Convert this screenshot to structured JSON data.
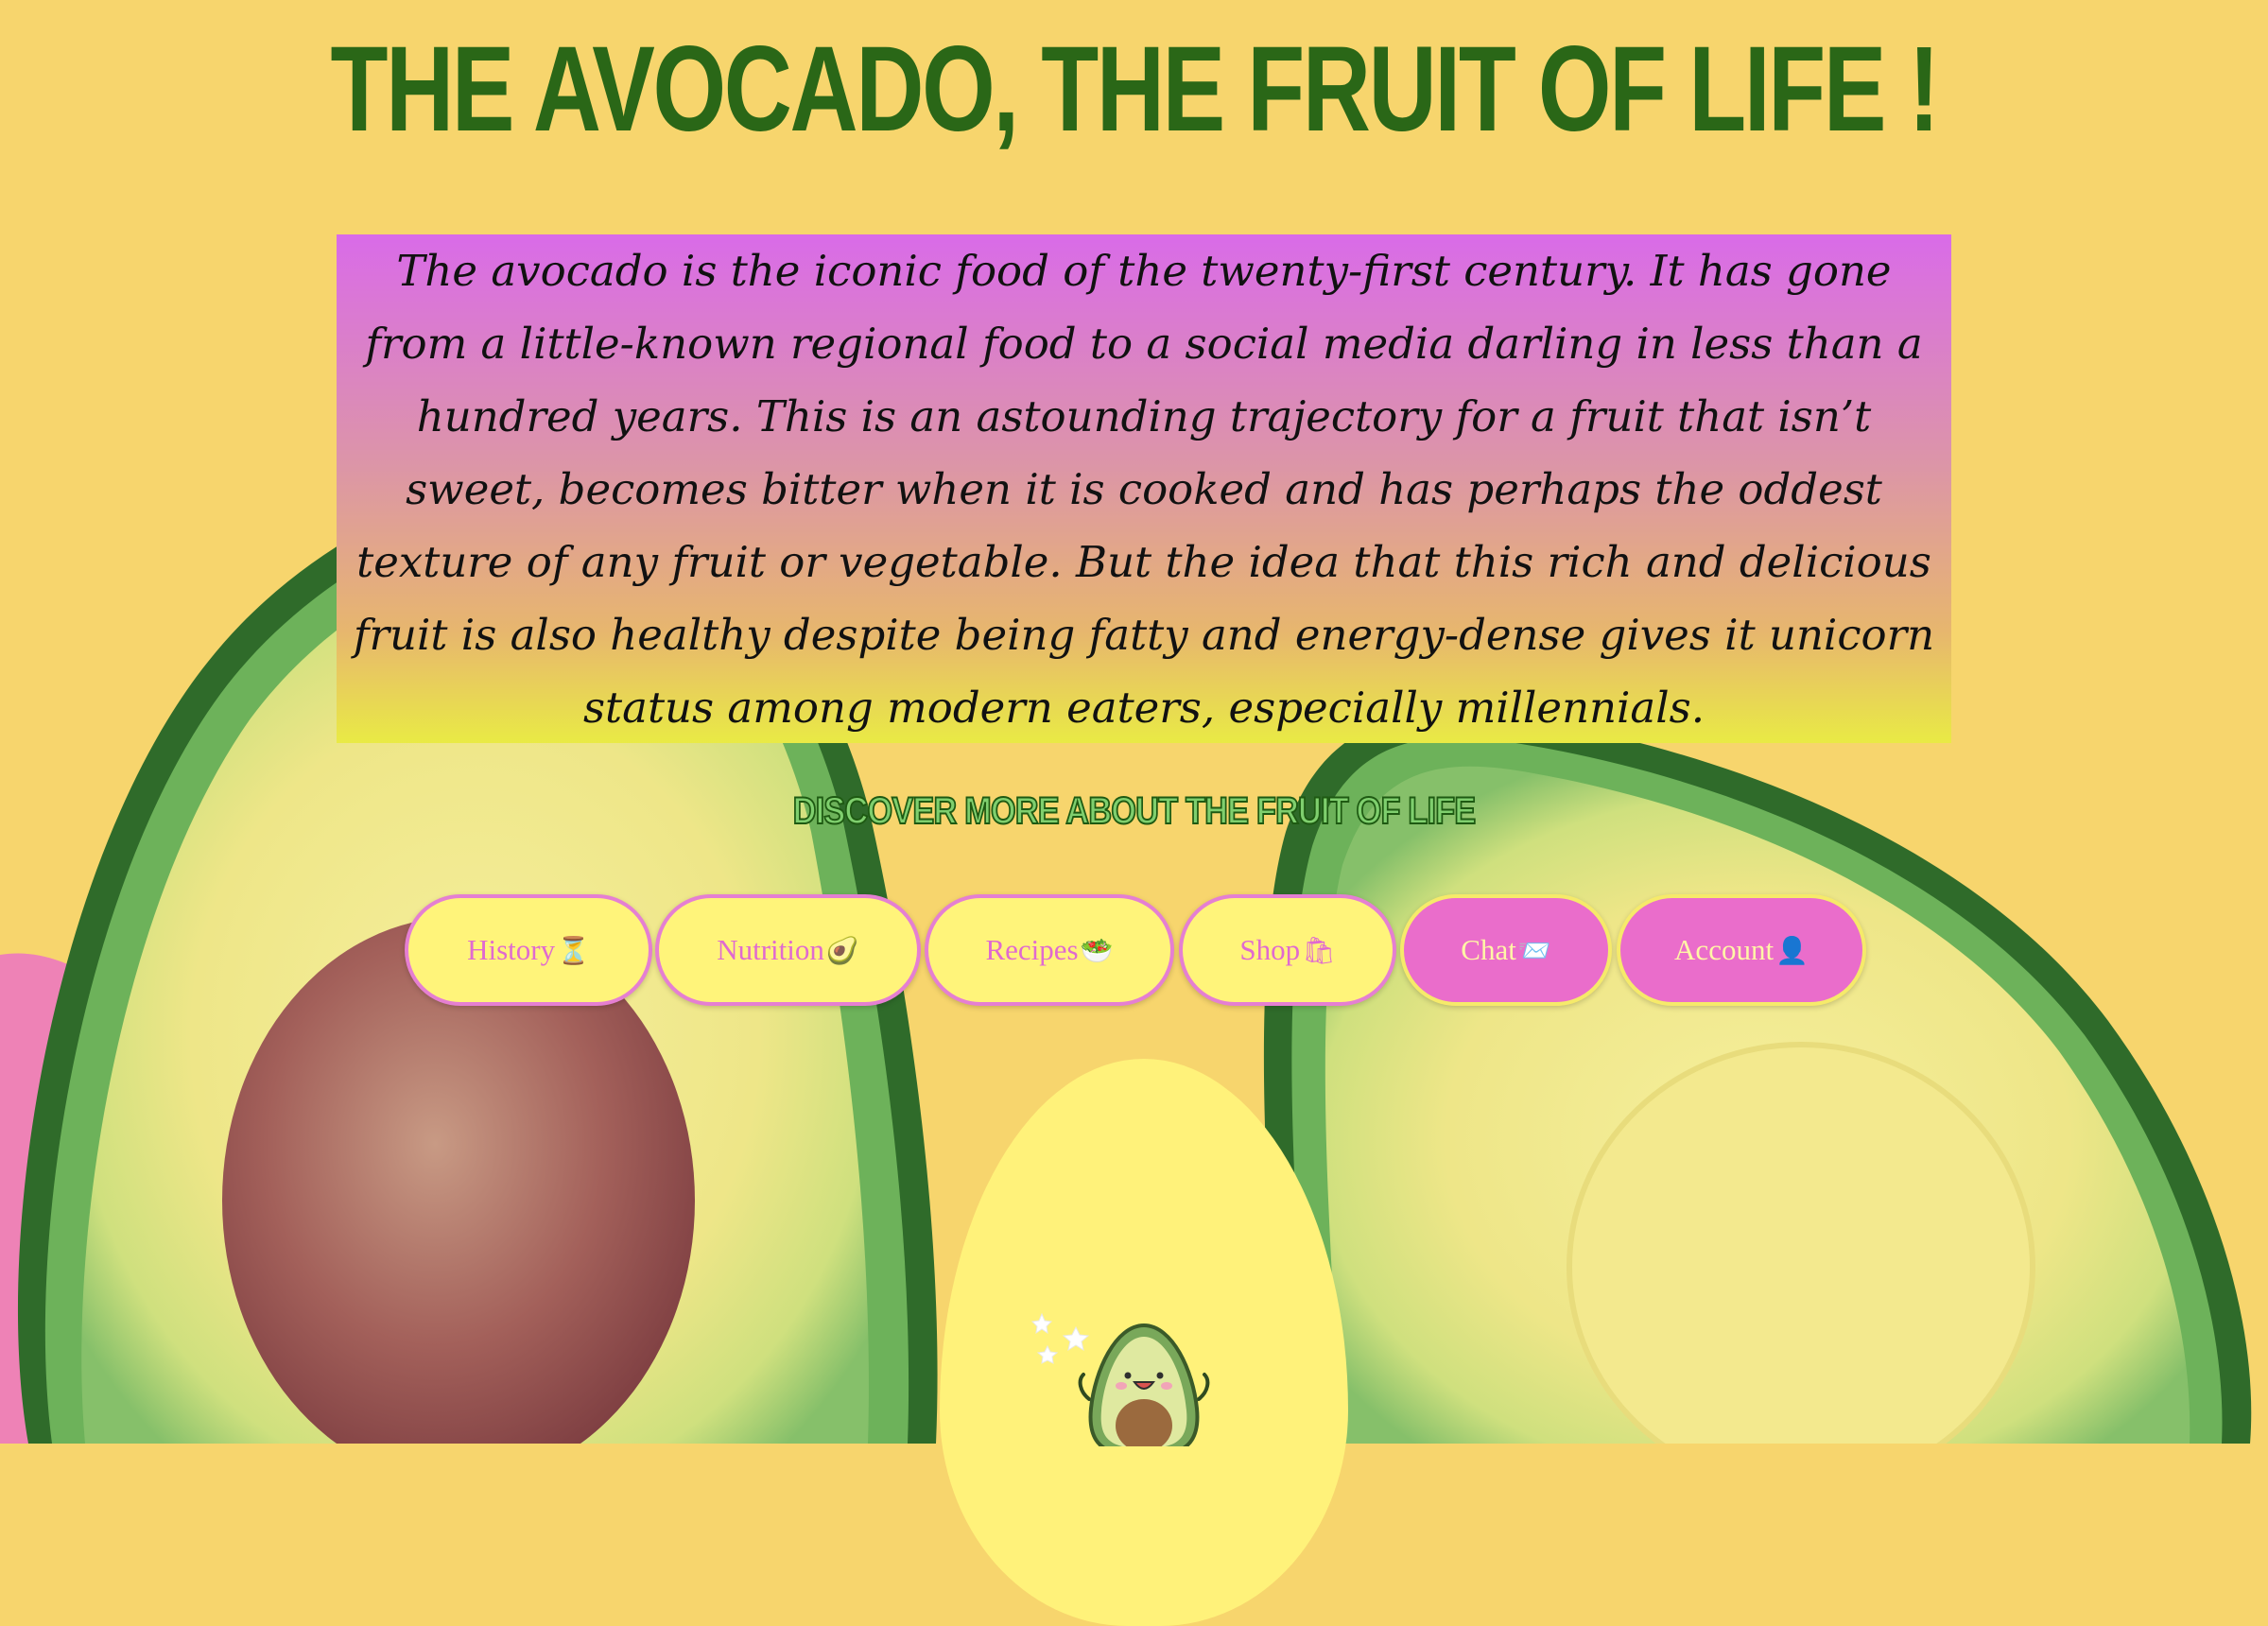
{
  "page": {
    "title": "THE AVOCADO, THE FRUIT OF LIFE !",
    "intro": "The avocado is the iconic food of the twenty-first century. It has gone from a little-known regional food to a social media darling in less than a hundred years. This is an astounding trajectory for a fruit that isn’t sweet, becomes bitter when it is cooked and has perhaps the oddest texture of any fruit or vegetable. But the idea that this rich and delicious fruit is also healthy despite being fatty and energy-dense gives it unicorn status among modern eaters, especially millennials.",
    "discover": "DISCOVER MORE ABOUT THE FRUIT OF LIFE"
  },
  "nav": {
    "items": [
      {
        "label": "History",
        "emoji": "⏳",
        "icon": "hourglass-icon"
      },
      {
        "label": "Nutrition",
        "emoji": "🥑",
        "icon": "avocado-icon"
      },
      {
        "label": "Recipes",
        "emoji": "🥗",
        "icon": "salad-icon"
      },
      {
        "label": "Shop",
        "emoji": "🛍",
        "icon": "shopping-bags-icon"
      },
      {
        "label": "Chat",
        "emoji": "📨",
        "icon": "envelope-icon"
      },
      {
        "label": "Account",
        "emoji": "👤",
        "icon": "user-icon"
      }
    ]
  },
  "colors": {
    "title": "#2a6717",
    "background": "#f7d56d",
    "button_light": "#fff47a",
    "button_dark": "#ea6dcb",
    "button_text_pink": "#e06ad0",
    "button_text_yellow": "#fff6a6"
  }
}
